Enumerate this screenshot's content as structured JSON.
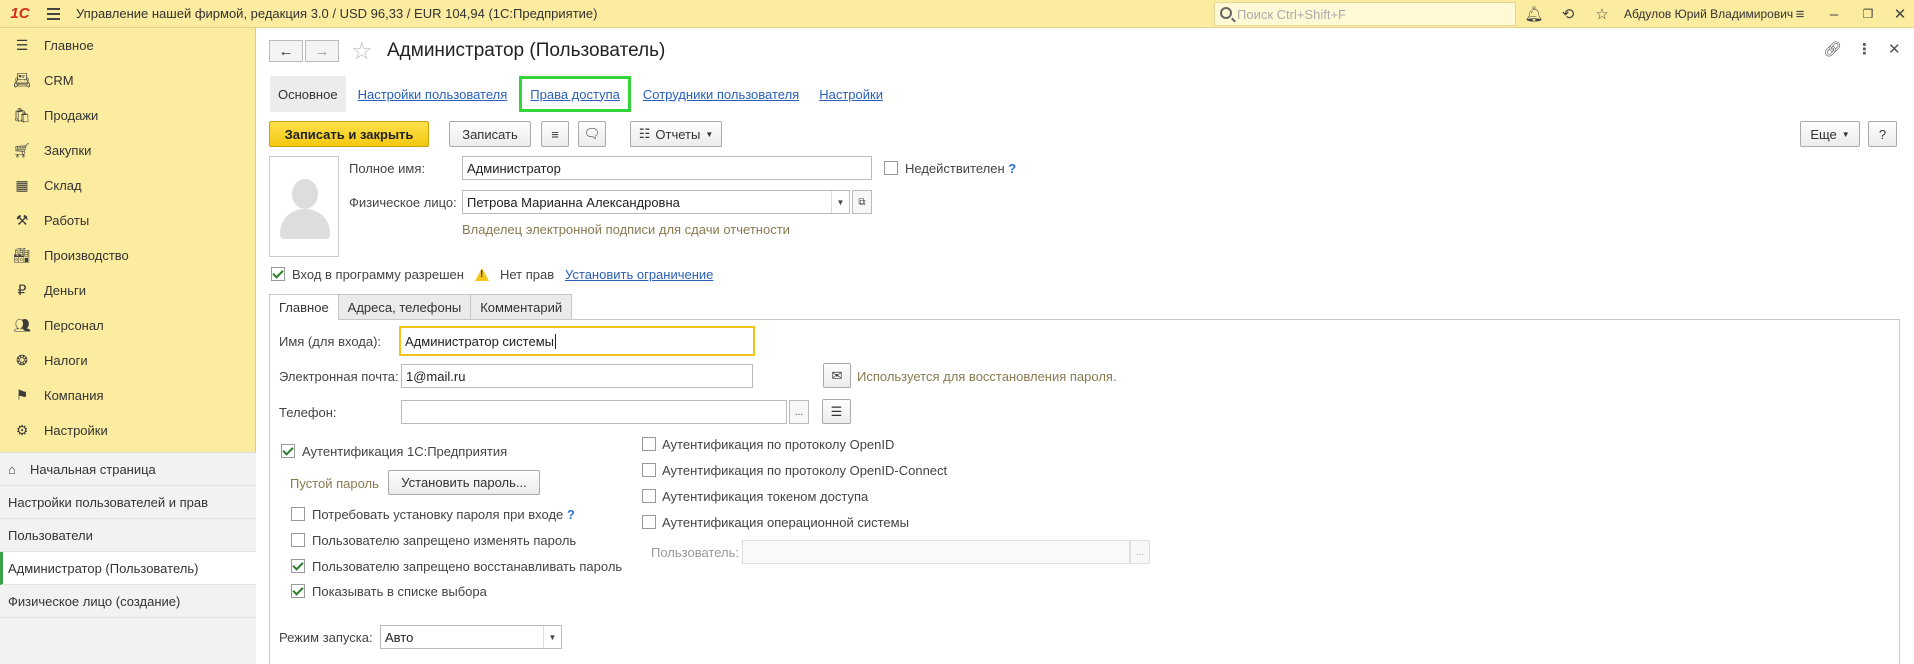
{
  "app": {
    "logo": "1С",
    "title": "Управление нашей фирмой, редакция 3.0 / USD 96,33 / EUR 104,94  (1С:Предприятие)",
    "search_placeholder": "Поиск Ctrl+Shift+F",
    "user_name": "Абдулов Юрий Владимирович"
  },
  "sidebar": {
    "items": [
      {
        "label": "Главное",
        "icon": "menu-lines-icon"
      },
      {
        "label": "CRM",
        "icon": "contact-card-icon"
      },
      {
        "label": "Продажи",
        "icon": "basket-icon"
      },
      {
        "label": "Закупки",
        "icon": "cart-icon"
      },
      {
        "label": "Склад",
        "icon": "warehouse-grid-icon"
      },
      {
        "label": "Работы",
        "icon": "tools-icon"
      },
      {
        "label": "Производство",
        "icon": "factory-icon"
      },
      {
        "label": "Деньги",
        "icon": "ruble-coin-icon"
      },
      {
        "label": "Персонал",
        "icon": "people-icon"
      },
      {
        "label": "Налоги",
        "icon": "emblem-icon"
      },
      {
        "label": "Компания",
        "icon": "flag-icon"
      },
      {
        "label": "Настройки",
        "icon": "gear-icon"
      }
    ],
    "open_windows": [
      {
        "label": "Начальная страница"
      },
      {
        "label": "Настройки пользователей и прав"
      },
      {
        "label": "Пользователи"
      },
      {
        "label": "Администратор (Пользователь)"
      },
      {
        "label": "Физическое лицо (создание)"
      }
    ]
  },
  "form": {
    "title": "Администратор (Пользователь)",
    "top_tabs": [
      "Основное",
      "Настройки пользователя",
      "Права доступа",
      "Сотрудники пользователя",
      "Настройки"
    ],
    "toolbar": {
      "save_close": "Записать и закрыть",
      "save": "Записать",
      "reports": "Отчеты",
      "more": "Еще",
      "help": "?"
    },
    "full_name_label": "Полное имя:",
    "full_name_value": "Администратор",
    "invalid_label": "Недействителен",
    "person_label": "Физическое лицо:",
    "person_value": "Петрова Марианна Александровна",
    "signature_hint": "Владелец электронной подписи для сдачи отчетности",
    "login_allowed_label": "Вход в программу разрешен",
    "no_rights_label": "Нет прав",
    "set_restriction_link": "Установить ограничение",
    "inner_tabs": [
      "Главное",
      "Адреса, телефоны",
      "Комментарий"
    ],
    "login_name_label": "Имя (для входа):",
    "login_name_value": "Администратор системы",
    "email_label": "Электронная почта:",
    "email_value": "1@mail.ru",
    "email_hint": "Используется для восстановления пароля.",
    "phone_label": "Телефон:",
    "phone_value": "",
    "auth_1c_label": "Аутентификация 1С:Предприятия",
    "empty_password_label": "Пустой пароль",
    "set_password_button": "Установить пароль...",
    "require_password_label": "Потребовать установку пароля при входе",
    "forbid_change_label": "Пользователю запрещено изменять пароль",
    "forbid_restore_label": "Пользователю запрещено восстанавливать пароль",
    "show_in_list_label": "Показывать в списке выбора",
    "openid_label": "Аутентификация по протоколу OpenID",
    "openid_connect_label": "Аутентификация по протоколу OpenID-Connect",
    "token_label": "Аутентификация токеном доступа",
    "os_auth_label": "Аутентификация операционной системы",
    "os_user_label": "Пользователь:",
    "os_user_value": "",
    "launch_mode_label": "Режим запуска:",
    "launch_mode_value": "Авто",
    "question_mark": "?"
  }
}
